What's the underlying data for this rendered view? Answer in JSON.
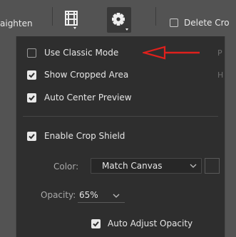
{
  "toolbar": {
    "straighten_label": "aighten",
    "delete_cropped_label": "Delete Cro",
    "grid_icon": "grid-overlay-icon",
    "settings_icon": "gear-icon"
  },
  "menu": {
    "items": [
      {
        "label": "Use Classic Mode",
        "checked": false,
        "shortcut": "P"
      },
      {
        "label": "Show Cropped Area",
        "checked": true,
        "shortcut": "H"
      },
      {
        "label": "Auto Center Preview",
        "checked": true,
        "shortcut": ""
      },
      {
        "label": "Enable Crop Shield",
        "checked": true,
        "shortcut": ""
      }
    ],
    "color_label": "Color:",
    "color_value": "Match Canvas",
    "opacity_label": "Opacity:",
    "opacity_value": "65%",
    "auto_adjust_label": "Auto Adjust Opacity",
    "auto_adjust_checked": true
  },
  "colors": {
    "annotation_arrow": "#e0201c",
    "panel_bg": "#2e2e2e",
    "toolbar_bg": "#535353"
  }
}
